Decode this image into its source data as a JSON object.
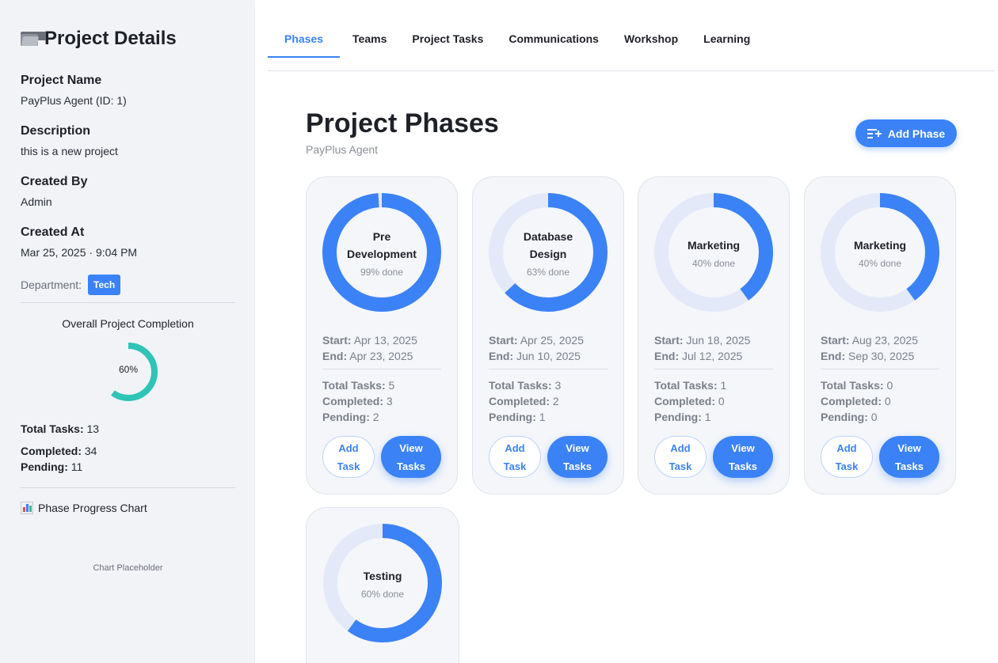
{
  "sidebar": {
    "title": "Project Details",
    "project_name_label": "Project Name",
    "project_name_value": "PayPlus Agent (ID: 1)",
    "description_label": "Description",
    "description_value": "this is a new project",
    "created_by_label": "Created By",
    "created_by_value": "Admin",
    "created_at_label": "Created At",
    "created_at_value": "Mar 25, 2025 · 9:04 PM",
    "department_label": "Department:",
    "department_value": "Tech",
    "overall_label": "Overall Project Completion",
    "overall_percent_text": "60%",
    "overall_percent": 60,
    "total_tasks_label": "Total Tasks:",
    "total_tasks_value": "13",
    "completed_label": "Completed:",
    "completed_value": "34",
    "pending_label": "Pending:",
    "pending_value": "11",
    "chart_title": "Phase Progress Chart",
    "chart_placeholder": "Chart Placeholder"
  },
  "tabs": [
    {
      "label": "Phases",
      "active": true
    },
    {
      "label": "Teams",
      "active": false
    },
    {
      "label": "Project Tasks",
      "active": false
    },
    {
      "label": "Communications",
      "active": false
    },
    {
      "label": "Workshop",
      "active": false
    },
    {
      "label": "Learning",
      "active": false
    }
  ],
  "main": {
    "title": "Project Phases",
    "subtitle": "PayPlus Agent",
    "add_phase_label": "Add Phase"
  },
  "labels": {
    "start": "Start:",
    "end": "End:",
    "total_tasks": "Total Tasks:",
    "completed": "Completed:",
    "pending": "Pending:",
    "add_task_1": "Add",
    "add_task_2": "Task",
    "view_tasks_1": "View",
    "view_tasks_2": "Tasks"
  },
  "phases": [
    {
      "name": "Pre Development",
      "percent": 99,
      "done_text": "99% done",
      "start": "Apr 13, 2025",
      "end": "Apr 23, 2025",
      "total": "5",
      "completed": "3",
      "pending": "2"
    },
    {
      "name": "Database Design",
      "percent": 63,
      "done_text": "63% done",
      "start": "Apr 25, 2025",
      "end": "Jun 10, 2025",
      "total": "3",
      "completed": "2",
      "pending": "1"
    },
    {
      "name": "Marketing",
      "percent": 40,
      "done_text": "40% done",
      "start": "Jun 18, 2025",
      "end": "Jul 12, 2025",
      "total": "1",
      "completed": "0",
      "pending": "1"
    },
    {
      "name": "Marketing",
      "percent": 40,
      "done_text": "40% done",
      "start": "Aug 23, 2025",
      "end": "Sep 30, 2025",
      "total": "0",
      "completed": "0",
      "pending": "0"
    },
    {
      "name": "Testing",
      "percent": 60,
      "done_text": "60% done",
      "start": "",
      "end": "",
      "total": "",
      "completed": "",
      "pending": ""
    }
  ],
  "colors": {
    "accent": "#3b82f6",
    "ring_track": "#e3e9f8",
    "overall_ring": "#2ec4b6"
  }
}
